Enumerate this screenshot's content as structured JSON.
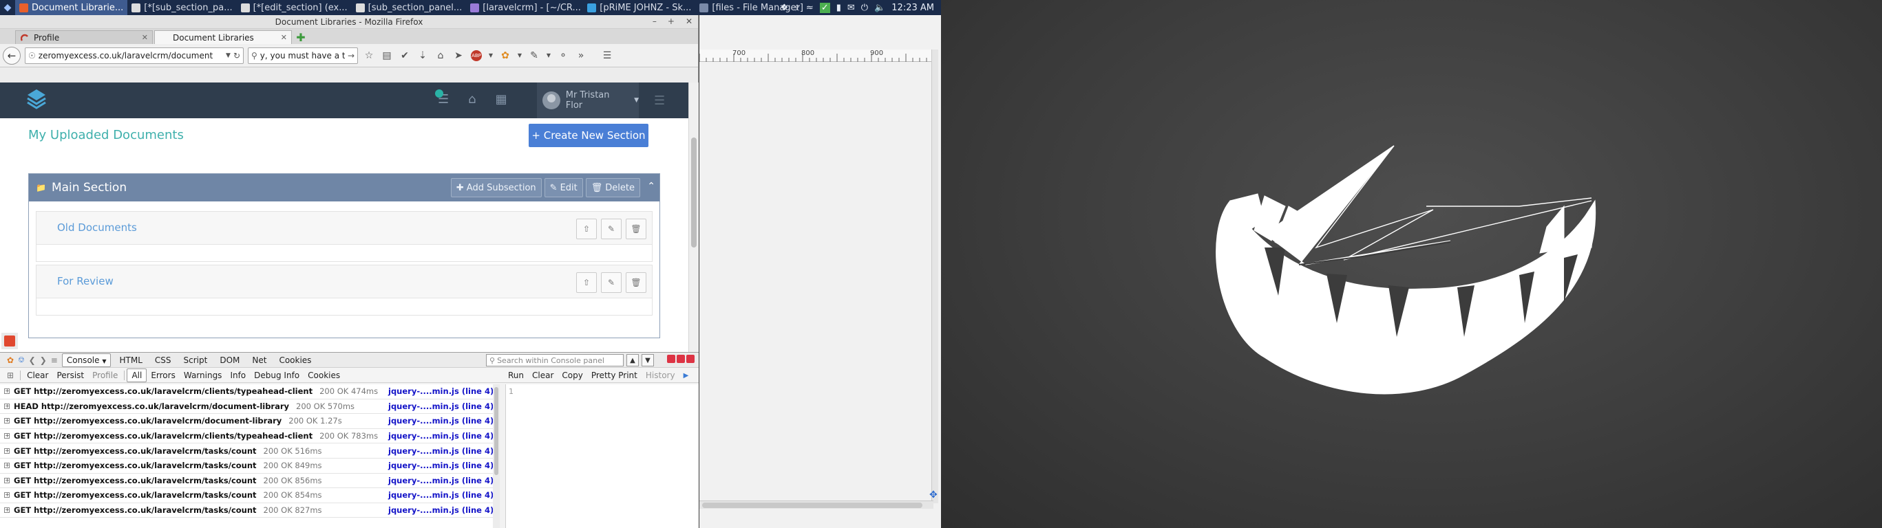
{
  "taskbar": {
    "tasks": [
      {
        "label": "Document Librarie...",
        "color": "#e8602c",
        "active": true
      },
      {
        "label": "[*[sub_section_pa...",
        "color": "#dddddd",
        "active": false
      },
      {
        "label": "[*[edit_section] (ex...",
        "color": "#dddddd",
        "active": false
      },
      {
        "label": "[sub_section_panel...",
        "color": "#dddddd",
        "active": false
      },
      {
        "label": "[laravelcrm] - [~/CR...",
        "color": "#9a7bd8",
        "active": false
      },
      {
        "label": "[pRiME JOHNZ - Sk...",
        "color": "#3aa0e0",
        "active": false
      },
      {
        "label": "[files - File Manager]",
        "color": "#7a8aa8",
        "active": false
      }
    ],
    "clock": "12:23 AM"
  },
  "browser": {
    "window_title": "Document Libraries - Mozilla Firefox",
    "tabs": [
      {
        "label": "Profile",
        "active": false
      },
      {
        "label": "Document Libraries",
        "active": true
      }
    ],
    "url": "zeromyexcess.co.uk/laravelcrm/document",
    "search_value": "y, you must have a t"
  },
  "app": {
    "user_name": "Mr Tristan Flor",
    "page_title": "My Uploaded Documents",
    "create_button": "+ Create New Section",
    "section": {
      "title": "Main Section",
      "add_subsection": "Add Subsection",
      "edit": "Edit",
      "delete": "Delete",
      "subsections": [
        {
          "title": "Old Documents"
        },
        {
          "title": "For Review"
        }
      ]
    }
  },
  "firebug": {
    "tabs": [
      "Console",
      "HTML",
      "CSS",
      "Script",
      "DOM",
      "Net",
      "Cookies"
    ],
    "search_placeholder": "Search within Console panel",
    "filters": [
      "Clear",
      "Persist",
      "Profile",
      "All",
      "Errors",
      "Warnings",
      "Info",
      "Debug Info",
      "Cookies"
    ],
    "cmd_actions": [
      "Run",
      "Clear",
      "Copy",
      "Pretty Print",
      "History"
    ],
    "cmd_line_number": "1",
    "log": [
      {
        "request": "GET http://zeromyexcess.co.uk/laravelcrm/clients/typeahead-client",
        "status": "200 OK 474ms",
        "source": "jquery-....min.js (line 4)"
      },
      {
        "request": "HEAD http://zeromyexcess.co.uk/laravelcrm/document-library",
        "status": "200 OK 570ms",
        "source": "jquery-....min.js (line 4)"
      },
      {
        "request": "GET http://zeromyexcess.co.uk/laravelcrm/document-library",
        "status": "200 OK 1.27s",
        "source": "jquery-....min.js (line 4)"
      },
      {
        "request": "GET http://zeromyexcess.co.uk/laravelcrm/clients/typeahead-client",
        "status": "200 OK 783ms",
        "source": "jquery-....min.js (line 4)"
      },
      {
        "request": "GET http://zeromyexcess.co.uk/laravelcrm/tasks/count",
        "status": "200 OK 516ms",
        "source": "jquery-....min.js (line 4)"
      },
      {
        "request": "GET http://zeromyexcess.co.uk/laravelcrm/tasks/count",
        "status": "200 OK 849ms",
        "source": "jquery-....min.js (line 4)"
      },
      {
        "request": "GET http://zeromyexcess.co.uk/laravelcrm/tasks/count",
        "status": "200 OK 856ms",
        "source": "jquery-....min.js (line 4)"
      },
      {
        "request": "GET http://zeromyexcess.co.uk/laravelcrm/tasks/count",
        "status": "200 OK 854ms",
        "source": "jquery-....min.js (line 4)"
      },
      {
        "request": "GET http://zeromyexcess.co.uk/laravelcrm/tasks/count",
        "status": "200 OK 827ms",
        "source": "jquery-....min.js (line 4)"
      }
    ]
  },
  "editor": {
    "ruler_labels": [
      "700",
      "800",
      "900"
    ]
  },
  "colors": {
    "accent_teal": "#3fb0ac",
    "primary_blue": "#4a7fd6",
    "section_header": "#6f86a6",
    "app_navbar": "#2f3d4d"
  }
}
